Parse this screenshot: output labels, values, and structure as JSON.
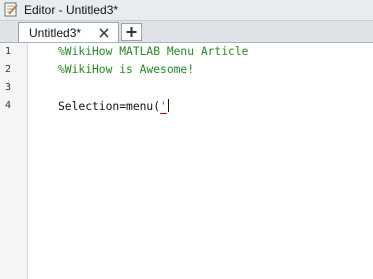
{
  "window": {
    "title": "Editor - Untitled3*",
    "icon": "editor-icon"
  },
  "tabs": [
    {
      "label": "Untitled3*",
      "close_icon": "close-icon"
    }
  ],
  "add_tab": {
    "icon": "plus-icon"
  },
  "editor": {
    "lines": [
      {
        "number": "1",
        "text": "%WikiHow MATLAB Menu Article"
      },
      {
        "number": "2",
        "text": "%WikiHow is Awesome!"
      },
      {
        "number": "3",
        "text": ""
      },
      {
        "number": "4",
        "text": "Selection=menu('",
        "code_part": "Selection=menu(",
        "string_part": "'"
      }
    ]
  },
  "colors": {
    "comment": "#228b22",
    "string": "#a020f0",
    "error_underline": "#e00000"
  }
}
